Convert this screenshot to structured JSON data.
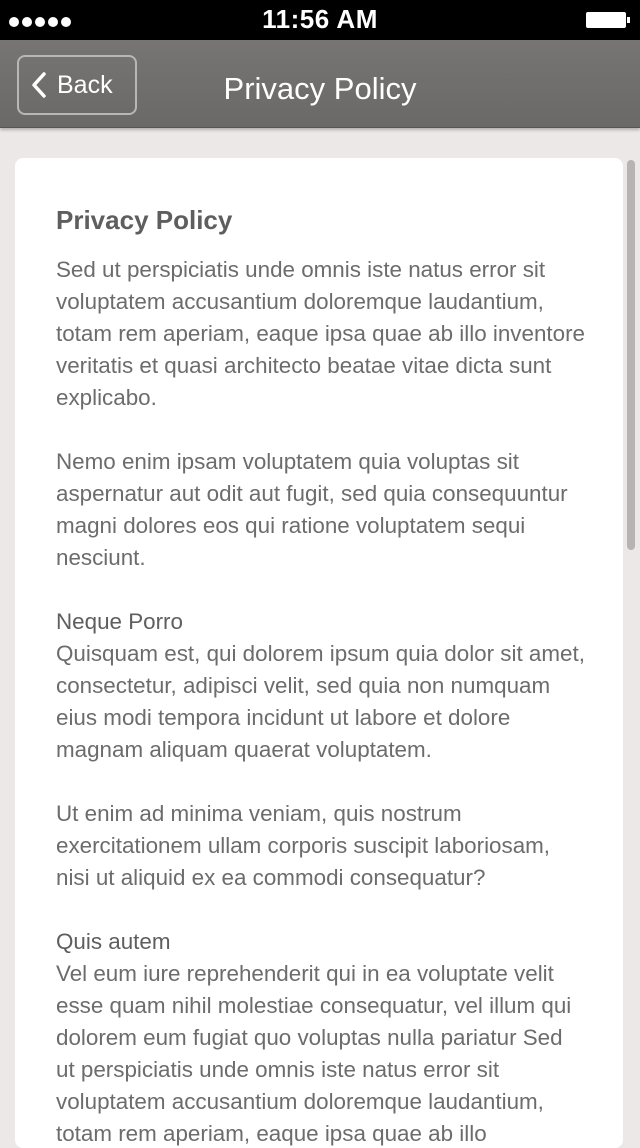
{
  "status_bar": {
    "time": "11:56 AM",
    "signal_icon": "signal-dots-icon",
    "battery_icon": "battery-icon"
  },
  "nav": {
    "back_label": "Back",
    "back_icon": "chevron-left-icon",
    "title": "Privacy Policy"
  },
  "document": {
    "heading": "Privacy Policy",
    "p1": "Sed ut perspiciatis unde omnis iste natus error sit voluptatem accusantium doloremque laudantium, totam rem aperiam, eaque ipsa quae ab illo inventore veritatis et quasi architecto beatae vitae dicta sunt explicabo.",
    "p2": "Nemo enim ipsam voluptatem quia voluptas sit aspernatur aut odit aut fugit, sed quia consequuntur magni dolores eos qui ratione voluptatem sequi nesciunt.",
    "section1_title": "Neque Porro",
    "section1_body": "Quisquam est, qui dolorem ipsum quia dolor sit amet, consectetur, adipisci velit, sed quia non numquam eius modi tempora incidunt ut labore et dolore magnam aliquam quaerat voluptatem.",
    "p3": "Ut enim ad minima veniam, quis nostrum exercitationem ullam corporis suscipit laboriosam, nisi ut aliquid ex ea commodi consequatur?",
    "section2_title": "Quis autem",
    "section2_body": "Vel eum iure reprehenderit qui in ea voluptate velit esse quam nihil molestiae consequatur, vel illum qui dolorem eum fugiat quo voluptas nulla pariatur Sed ut perspiciatis unde omnis iste natus error sit voluptatem accusantium doloremque laudantium, totam rem aperiam, eaque ipsa quae ab illo"
  }
}
